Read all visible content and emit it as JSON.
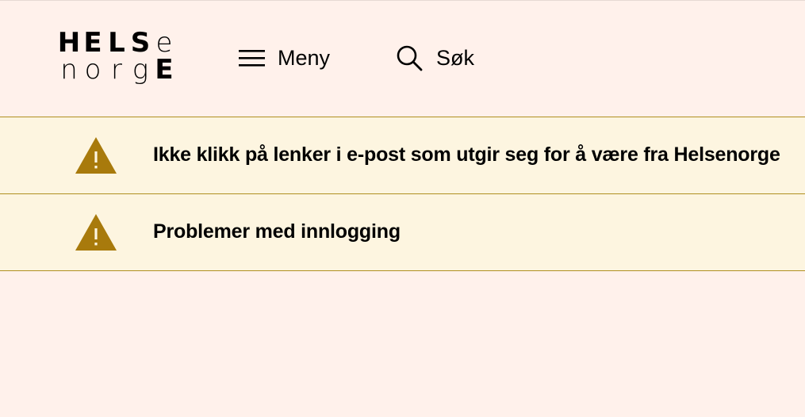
{
  "header": {
    "logo": {
      "row1": [
        "H",
        "E",
        "L",
        "S",
        "e"
      ],
      "row2": [
        "n",
        "o",
        "r",
        "g",
        "E"
      ]
    },
    "menu_label": "Meny",
    "search_label": "Søk"
  },
  "alerts": [
    {
      "text": "Ikke klikk på lenker i e-post som utgir seg for å være fra Helsenorge",
      "icon": "warning-icon"
    },
    {
      "text": "Problemer med innlogging",
      "icon": "warning-icon"
    }
  ],
  "colors": {
    "page_background": "#fff1eb",
    "alert_background": "#fdf5e0",
    "alert_border": "#b08f21",
    "warning_icon": "#a87a0c"
  }
}
